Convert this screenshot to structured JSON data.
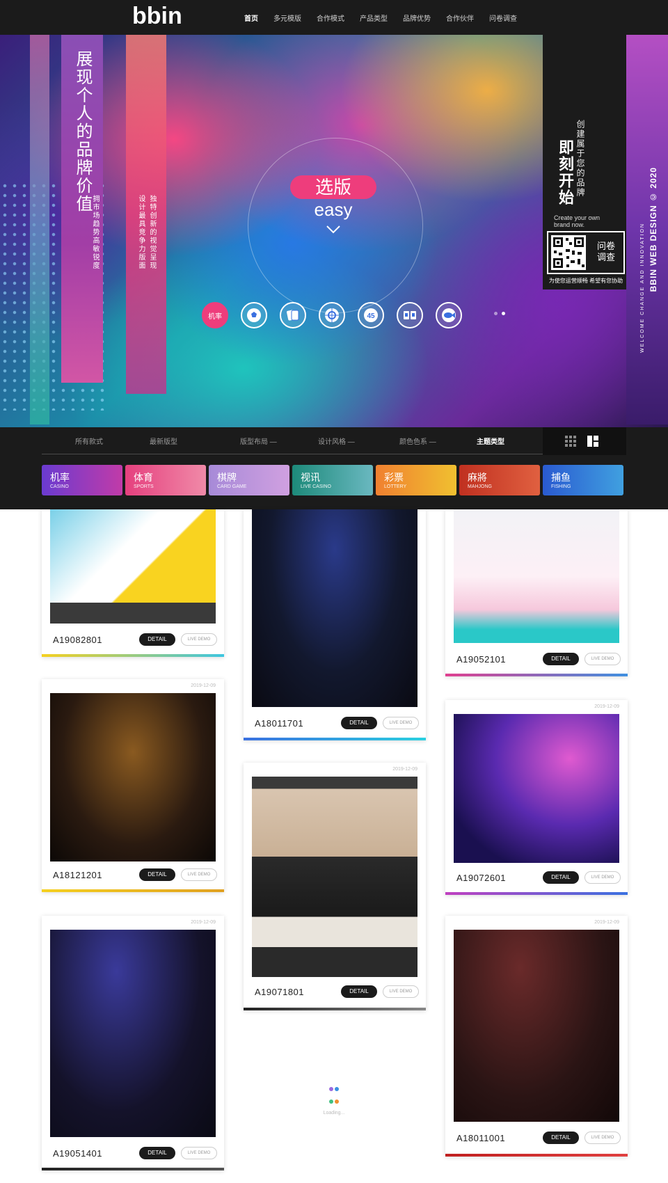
{
  "logo": {
    "text": "bbin"
  },
  "nav": [
    "首页",
    "多元模版",
    "合作模式",
    "产品类型",
    "品牌优势",
    "合作伙伴",
    "问卷调查"
  ],
  "hero": {
    "headline": "展现个人的品牌价值",
    "subline_1": "拥市场趋势高敏锐度",
    "subline_2a": "设计最具竞争力版面",
    "subline_2b": "独特创新的视觉呈现",
    "cta_pill": "选版",
    "cta_word": "easy",
    "category_active": "机率",
    "start_title": "即刻开始",
    "start_sub": "创建属于您的品牌",
    "start_en": "Create your own brand now.",
    "qr_label": "问卷调查",
    "qr_note": "为使您运营顺畅 希望有您协助",
    "brand_vertical": "BBIN WEB DESIGN © 2020",
    "brand_vertical_sub": "WELCOME CHANGE AND INNOVATION"
  },
  "filters": [
    "所有款式",
    "最新版型",
    "版型布局 —",
    "设计风格 —",
    "颜色色系 —",
    "主题类型"
  ],
  "categories": [
    {
      "cn": "机率",
      "en": "CASINO",
      "color": "#6a3bd0",
      "color2": "#c13ba8"
    },
    {
      "cn": "体育",
      "en": "SPORTS",
      "color": "#e5407e",
      "color2": "#f08aa8"
    },
    {
      "cn": "棋牌",
      "en": "CARD GAME",
      "color": "#a78ad8",
      "color2": "#d0a0e0"
    },
    {
      "cn": "视讯",
      "en": "LIVE CASINO",
      "color": "#1d8a7a",
      "color2": "#6ab8c0"
    },
    {
      "cn": "彩票",
      "en": "LOTTERY",
      "color": "#f08030",
      "color2": "#f0c030"
    },
    {
      "cn": "麻將",
      "en": "MAHJONG",
      "color": "#c03020",
      "color2": "#e06040"
    },
    {
      "cn": "捕鱼",
      "en": "FISHING",
      "color": "#2a5ad0",
      "color2": "#40a0e0"
    }
  ],
  "cards": [
    {
      "code": "A19082801",
      "date": "",
      "bar": "#f5d020",
      "bar2": "#3ec6e0"
    },
    {
      "code": "A18011701",
      "date": "",
      "bar": "#3a70e0",
      "bar2": "#2ad0e0"
    },
    {
      "code": "A19052101",
      "date": "",
      "bar": "#e04090",
      "bar2": "#4090e0"
    },
    {
      "code": "A18121201",
      "date": "2019-12-09",
      "bar": "#f5d020",
      "bar2": "#e0a020"
    },
    {
      "code": "A19072601",
      "date": "2019-12-09",
      "bar": "#c040c0",
      "bar2": "#3a70e0"
    },
    {
      "code": "A19071801",
      "date": "2019-12-09",
      "bar": "#222222",
      "bar2": "#888888"
    },
    {
      "code": "A19051401",
      "date": "2019-12-09",
      "bar": "#222222",
      "bar2": "#555555"
    },
    {
      "code": "A18011001",
      "date": "2019-12-09",
      "bar": "#c02020",
      "bar2": "#e04040"
    }
  ],
  "buttons": {
    "detail": "DETAIL",
    "live": "LIVE DEMO"
  },
  "loading": {
    "text": "Loading..."
  }
}
